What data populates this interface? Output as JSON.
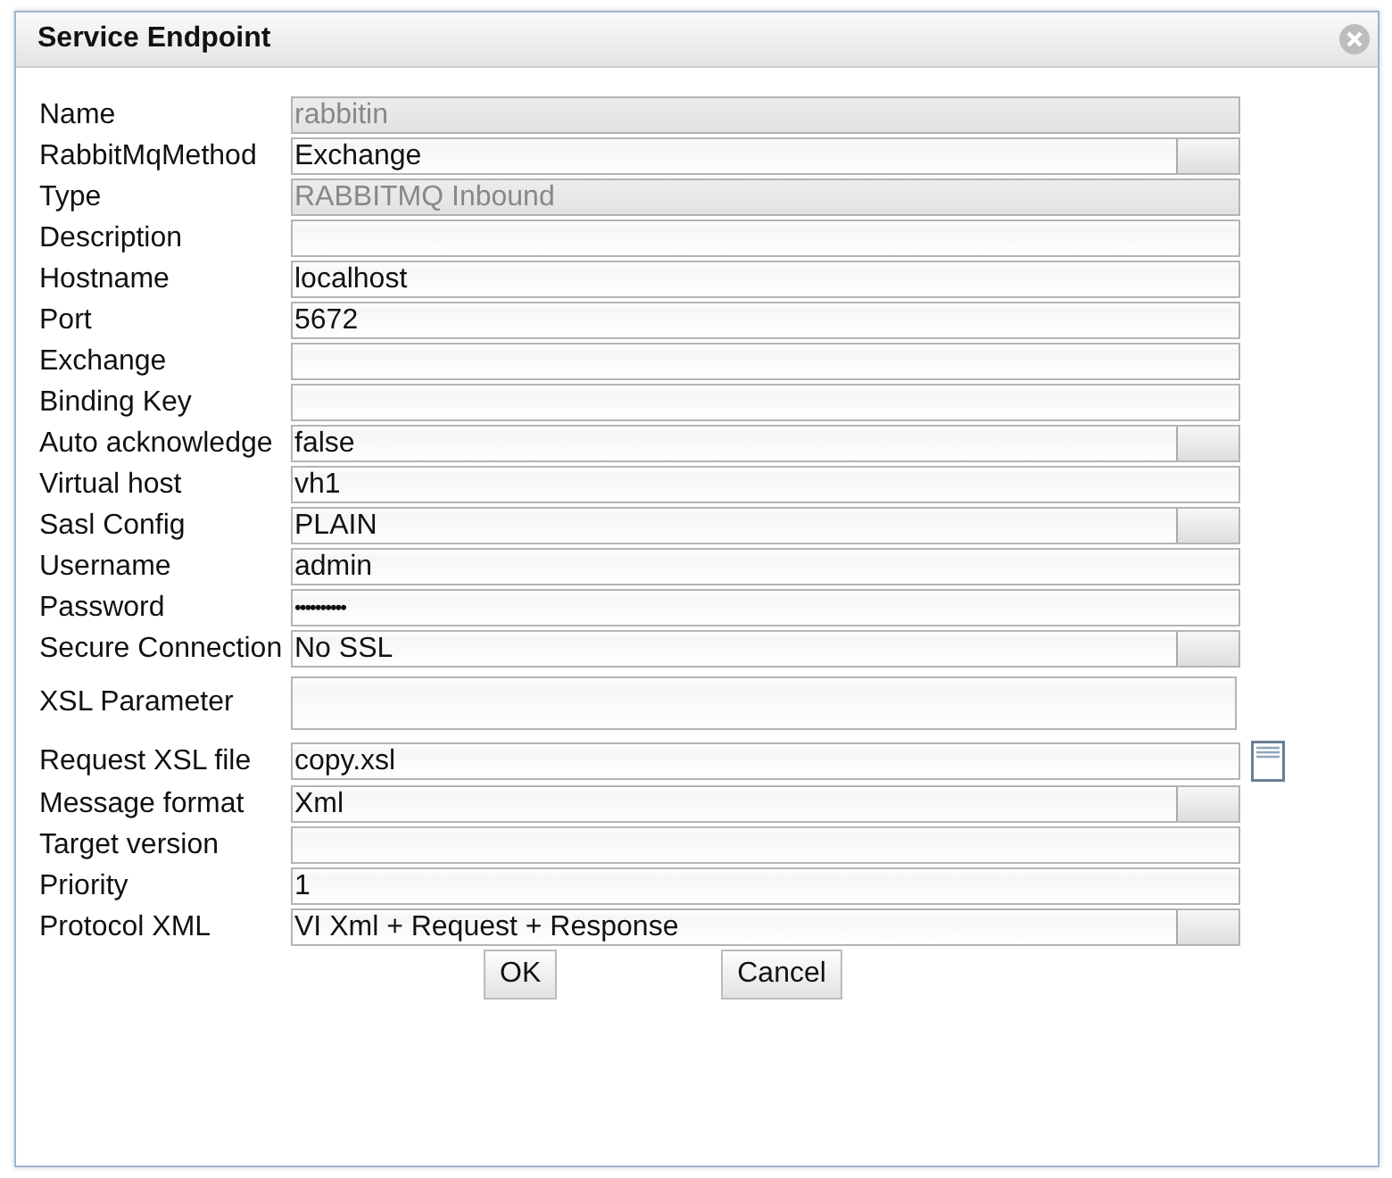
{
  "dialog": {
    "title": "Service Endpoint"
  },
  "fields": [
    {
      "label": "Name",
      "kind": "readonly",
      "value": "rabbitin"
    },
    {
      "label": "RabbitMqMethod",
      "kind": "select",
      "value": "Exchange"
    },
    {
      "label": "Type",
      "kind": "readonly",
      "value": "RABBITMQ Inbound"
    },
    {
      "label": "Description",
      "kind": "text"
    },
    {
      "label": "Hostname",
      "kind": "text",
      "value": "localhost"
    },
    {
      "label": "Port",
      "kind": "text",
      "value": "5672"
    },
    {
      "label": "Exchange",
      "kind": "text"
    },
    {
      "label": "Binding Key",
      "kind": "text"
    },
    {
      "label": "Auto acknowledge",
      "kind": "select",
      "value": "false"
    },
    {
      "label": "Virtual host",
      "kind": "text",
      "value": "vh1"
    },
    {
      "label": "Sasl Config",
      "kind": "select",
      "value": "PLAIN"
    },
    {
      "label": "Username",
      "kind": "text",
      "value": "admin"
    },
    {
      "label": "Password",
      "kind": "password",
      "value": "••••••••••"
    },
    {
      "label": "Secure Connection",
      "kind": "select",
      "value": "No SSL"
    },
    {
      "label": "XSL Parameter",
      "kind": "textarea"
    },
    {
      "label": "Request XSL file",
      "kind": "file",
      "value": "copy.xsl"
    },
    {
      "label": "Message format",
      "kind": "select",
      "value": "Xml"
    },
    {
      "label": "Target version",
      "kind": "text"
    },
    {
      "label": "Priority",
      "kind": "text",
      "value": "1"
    },
    {
      "label": "Protocol XML",
      "kind": "select",
      "value": "VI Xml + Request + Response"
    }
  ],
  "buttons": [
    "OK",
    "Cancel"
  ]
}
